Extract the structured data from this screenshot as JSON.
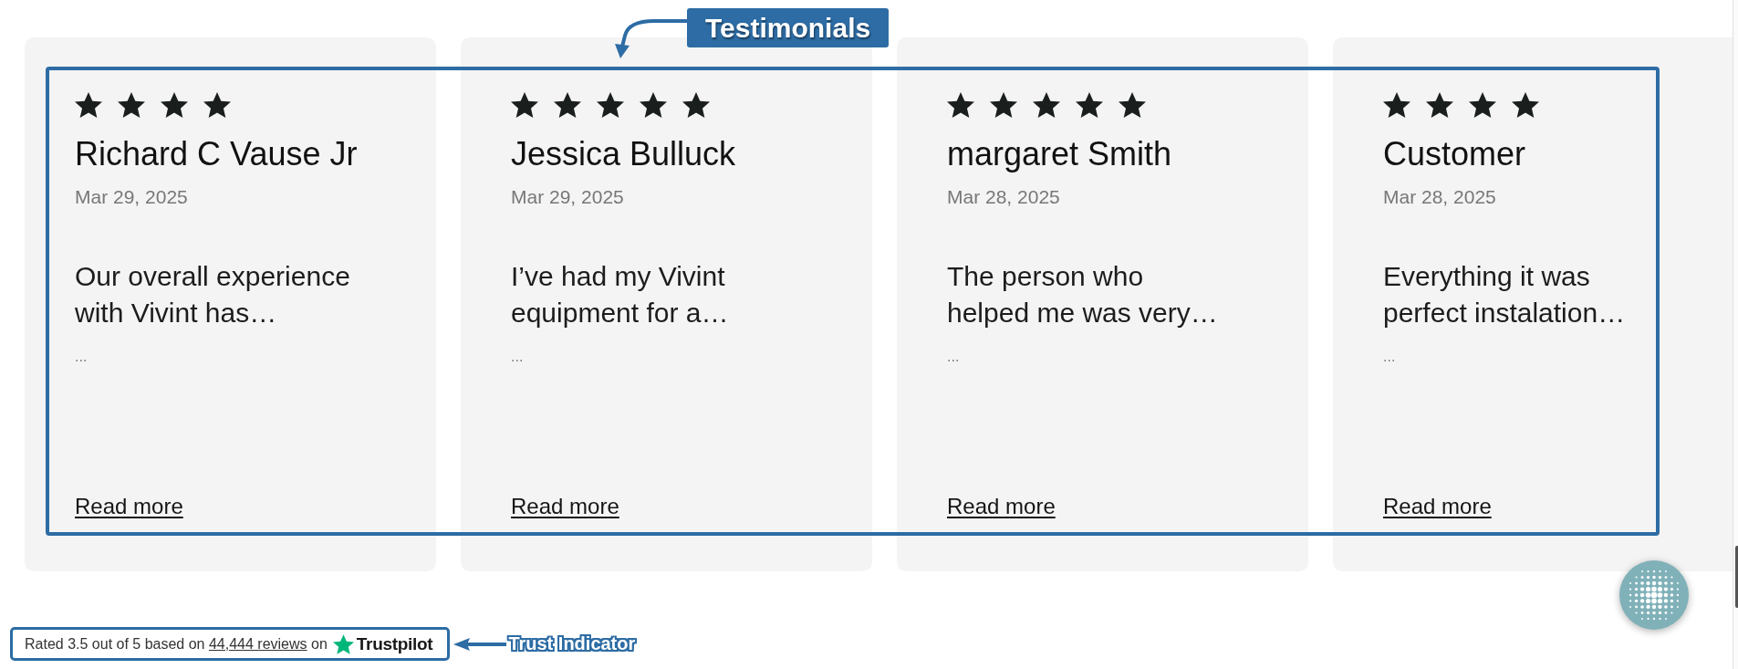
{
  "testimonials": {
    "annotation": "Testimonials",
    "reviews": [
      {
        "stars": 4,
        "name": "Richard C Vause Jr",
        "date": "Mar 29, 2025",
        "excerpt": "Our overall experience with Vivint has…",
        "more": "...",
        "link": "Read more"
      },
      {
        "stars": 5,
        "name": "Jessica Bulluck",
        "date": "Mar 29, 2025",
        "excerpt": "I’ve had my Vivint equipment for a…",
        "more": "...",
        "link": "Read more"
      },
      {
        "stars": 5,
        "name": "margaret Smith",
        "date": "Mar 28, 2025",
        "excerpt": "The person who helped me was very…",
        "more": "...",
        "link": "Read more"
      },
      {
        "stars": 4,
        "name": "Customer",
        "date": "Mar 28, 2025",
        "excerpt": "Everything it was perfect instalation…",
        "more": "...",
        "link": "Read more"
      }
    ]
  },
  "trust_indicator": {
    "annotation": "Trust Indicator",
    "rating_text": "Rated 3.5 out of 5 based on",
    "reviews_link": "44,444 reviews",
    "rating_suffix": "on",
    "brand": "Trustpilot"
  }
}
